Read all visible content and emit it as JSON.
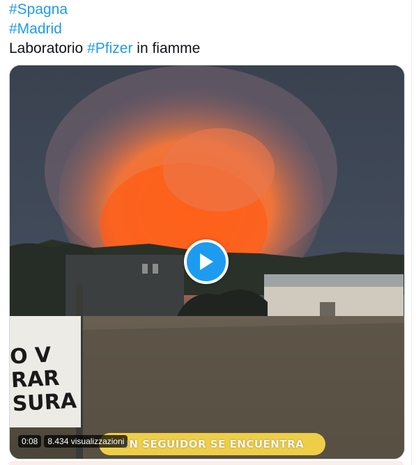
{
  "tweet": {
    "hashtag_1": "#Spagna",
    "hashtag_2": "#Madrid",
    "text_before": "Laboratorio ",
    "hashtag_3": "#Pfizer",
    "text_after": " in fiamme"
  },
  "video": {
    "time": "0:08",
    "views": "8.434 visualizzazioni",
    "caption": "UN SEGUIDOR SE ENCUENTRA",
    "sign_text": "O V\nRAR\nSURA"
  },
  "colors": {
    "link": "#1d9bf0",
    "text": "#0f1419"
  },
  "icons": {
    "play": "play-icon"
  }
}
